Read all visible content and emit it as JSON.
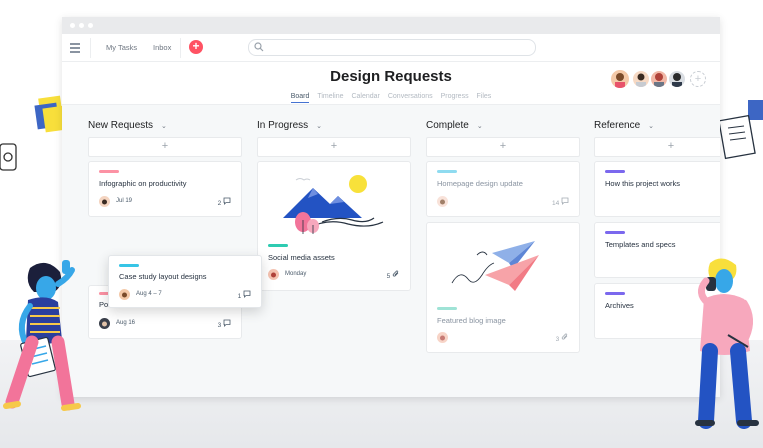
{
  "window": {
    "dots": [
      "dot1",
      "dot2",
      "dot3"
    ]
  },
  "nav": {
    "menu_icon": "hamburger-icon",
    "links": [
      "My Tasks",
      "Inbox"
    ],
    "add_icon": "plus-icon",
    "add_label": "+",
    "search_icon": "search-icon",
    "search_placeholder": ""
  },
  "project": {
    "title": "Design Requests",
    "tabs": [
      "Board",
      "Timeline",
      "Calendar",
      "Conversations",
      "Progress",
      "Files"
    ],
    "active_tab": "Board",
    "add_member_label": "+"
  },
  "columns": [
    {
      "title": "New Requests",
      "add_label": "+"
    },
    {
      "title": "In Progress",
      "add_label": "+"
    },
    {
      "title": "Complete",
      "add_label": "+"
    },
    {
      "title": "Reference",
      "add_label": "+"
    }
  ],
  "cards": {
    "new_requests": [
      {
        "tag_color": "#fc92a4",
        "title": "Infographic on productivity",
        "date": "Jul 19",
        "count": "2",
        "count_icon": "comment-icon"
      },
      {
        "tag_color": "#fc92a4",
        "title": "Pos",
        "date": "Aug 16",
        "count": "3",
        "count_icon": "comment-icon"
      }
    ],
    "dragging": {
      "tag_color": "#37c5e6",
      "title": "Case study layout designs",
      "date": "Aug 4 – 7",
      "count": "1",
      "count_icon": "comment-icon"
    },
    "in_progress": [
      {
        "tag_color": "#2ecbb1",
        "title": "Social media assets",
        "date": "Monday",
        "count": "5",
        "count_icon": "attachment-icon",
        "image": "mountain-illustration"
      }
    ],
    "complete": [
      {
        "tag_color": "#8fdbf0",
        "title": "Homepage design update",
        "count": "14",
        "count_icon": "comment-icon"
      },
      {
        "tag_color": "#9fe3d6",
        "title": "Featured blog image",
        "count": "3",
        "count_icon": "attachment-icon",
        "image": "paper-planes-illustration"
      }
    ],
    "reference": [
      {
        "tag_color": "#7b68ee",
        "title": "How this project works"
      },
      {
        "tag_color": "#7b68ee",
        "title": "Templates and specs"
      },
      {
        "tag_color": "#7b68ee",
        "title": "Archives"
      }
    ]
  },
  "colors": {
    "accent": "#ff5263",
    "tab_underline": "#4573d2",
    "reference_tag": "#7b68ee"
  }
}
